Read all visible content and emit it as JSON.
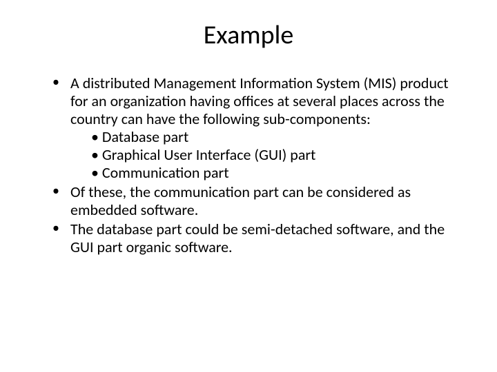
{
  "slide": {
    "title": "Example",
    "bullets": [
      {
        "text": "A distributed Management Information System (MIS) product for an organization having offices at several places across the country can have the following sub-components:",
        "sub": [
          "• Database part",
          "• Graphical User Interface (GUI) part",
          "• Communication part"
        ]
      },
      {
        "text": "Of these, the communication part can be considered as embedded software.",
        "sub": []
      },
      {
        "text": "The database part could be semi-detached software, and the GUI part organic  software.",
        "sub": []
      }
    ]
  }
}
